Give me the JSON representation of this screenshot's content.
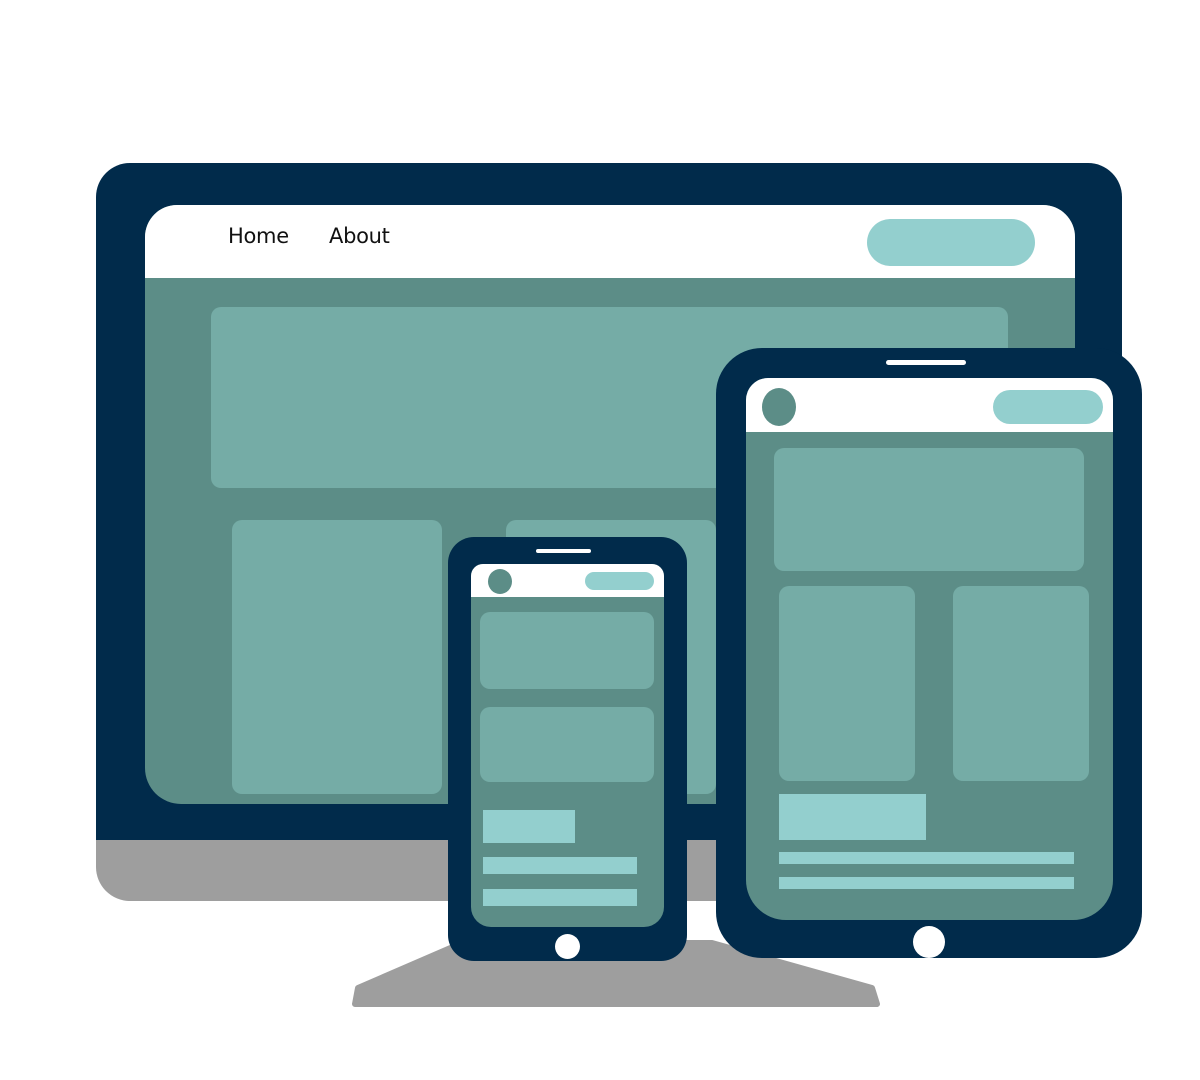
{
  "desktop": {
    "nav": [
      {
        "label": "Home"
      },
      {
        "label": "About"
      }
    ]
  },
  "colors": {
    "device_frame": "#012b4b",
    "screen_background": "#5c8d87",
    "card": "#75aca6",
    "accent": "#93cfce",
    "stand": "#9e9e9e",
    "header": "#ffffff"
  }
}
